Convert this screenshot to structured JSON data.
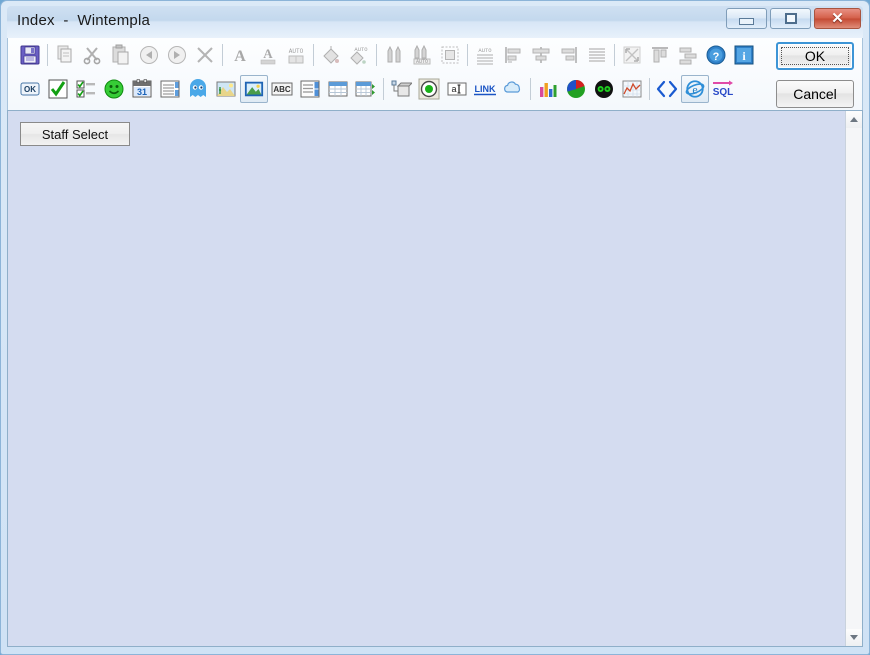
{
  "window": {
    "title": "Index  -  Wintempla",
    "controls": {
      "minimize": "minimize",
      "maximize": "maximize",
      "close": "✕"
    }
  },
  "dialog_buttons": {
    "ok_label": "OK",
    "cancel_label": "Cancel"
  },
  "toolbar": {
    "row1": [
      {
        "name": "save-icon",
        "type": "icon",
        "enabled": true
      },
      {
        "name": "separator",
        "type": "sep"
      },
      {
        "name": "copy-icon",
        "type": "icon",
        "enabled": false
      },
      {
        "name": "cut-icon",
        "type": "icon",
        "enabled": false
      },
      {
        "name": "paste-icon",
        "type": "icon",
        "enabled": false
      },
      {
        "name": "undo-icon",
        "type": "icon",
        "enabled": false
      },
      {
        "name": "redo-icon",
        "type": "icon",
        "enabled": false
      },
      {
        "name": "delete-x-icon",
        "type": "icon",
        "enabled": false
      },
      {
        "name": "separator",
        "type": "sep"
      },
      {
        "name": "font-bold-a-icon",
        "type": "icon",
        "enabled": false
      },
      {
        "name": "font-color-a-icon",
        "type": "icon",
        "enabled": false
      },
      {
        "name": "font-auto-icon",
        "type": "icon",
        "enabled": false,
        "label": "AUTO"
      },
      {
        "name": "separator",
        "type": "sep"
      },
      {
        "name": "fill-bucket-icon",
        "type": "icon",
        "enabled": false
      },
      {
        "name": "fill-auto-icon",
        "type": "icon",
        "enabled": false,
        "label": "AUTO"
      },
      {
        "name": "separator",
        "type": "sep"
      },
      {
        "name": "pen-icon",
        "type": "icon",
        "enabled": false
      },
      {
        "name": "pen-auto-icon",
        "type": "icon",
        "enabled": false,
        "label": "AUTO"
      },
      {
        "name": "border-frame-icon",
        "type": "icon",
        "enabled": false
      },
      {
        "name": "separator",
        "type": "sep"
      },
      {
        "name": "align-auto-icon",
        "type": "icon",
        "enabled": false,
        "label": "AUTO"
      },
      {
        "name": "align-left-icon",
        "type": "icon",
        "enabled": false
      },
      {
        "name": "align-center-icon",
        "type": "icon",
        "enabled": false
      },
      {
        "name": "align-right-icon",
        "type": "icon",
        "enabled": false
      },
      {
        "name": "align-justify-icon",
        "type": "icon",
        "enabled": false
      },
      {
        "name": "separator",
        "type": "sep"
      },
      {
        "name": "resize-icon",
        "type": "icon",
        "enabled": false
      },
      {
        "name": "align-top-icon",
        "type": "icon",
        "enabled": false
      },
      {
        "name": "distribute-icon",
        "type": "icon",
        "enabled": false
      },
      {
        "name": "help-icon",
        "type": "icon",
        "enabled": true
      },
      {
        "name": "info-icon",
        "type": "icon",
        "enabled": true
      }
    ],
    "row2": [
      {
        "name": "ok-button-icon",
        "type": "icon",
        "label": "OK"
      },
      {
        "name": "checkbox-icon",
        "type": "icon"
      },
      {
        "name": "checklist-icon",
        "type": "icon"
      },
      {
        "name": "smiley-icon",
        "type": "icon"
      },
      {
        "name": "calendar-icon",
        "type": "icon",
        "label": "31"
      },
      {
        "name": "listbox-icon",
        "type": "icon"
      },
      {
        "name": "ghost-icon",
        "type": "icon"
      },
      {
        "name": "picture-icon",
        "type": "icon"
      },
      {
        "name": "image-frame-icon",
        "type": "icon",
        "selected": true
      },
      {
        "name": "abc-textbox-icon",
        "type": "icon",
        "label": "ABC"
      },
      {
        "name": "combobox-icon",
        "type": "icon"
      },
      {
        "name": "grid-icon",
        "type": "icon"
      },
      {
        "name": "grid-add-icon",
        "type": "icon"
      },
      {
        "name": "separator",
        "type": "sep"
      },
      {
        "name": "object-node-icon",
        "type": "icon"
      },
      {
        "name": "radio-button-icon",
        "type": "icon"
      },
      {
        "name": "text-input-icon",
        "type": "icon",
        "label": "a"
      },
      {
        "name": "link-icon",
        "type": "icon",
        "label": "LINK"
      },
      {
        "name": "cloud-icon",
        "type": "icon"
      },
      {
        "name": "separator",
        "type": "sep"
      },
      {
        "name": "bar-chart-icon",
        "type": "icon"
      },
      {
        "name": "pie-chart-icon",
        "type": "icon"
      },
      {
        "name": "goggles-icon",
        "type": "icon"
      },
      {
        "name": "line-chart-icon",
        "type": "icon"
      },
      {
        "name": "separator",
        "type": "sep"
      },
      {
        "name": "code-brackets-icon",
        "type": "icon",
        "label": "<>"
      },
      {
        "name": "browser-icon",
        "type": "icon",
        "selected": true
      },
      {
        "name": "sql-icon",
        "type": "icon",
        "label": "SQL"
      }
    ]
  },
  "client": {
    "staff_select_label": "Staff Select"
  },
  "scrollbar": {
    "up_arrow": "▲",
    "down_arrow": "▼"
  },
  "colors": {
    "client_background": "#d4dcf0",
    "frame": "#cfe2f5",
    "accent_blue": "#3d95d6",
    "close_red": "#c44a33"
  }
}
